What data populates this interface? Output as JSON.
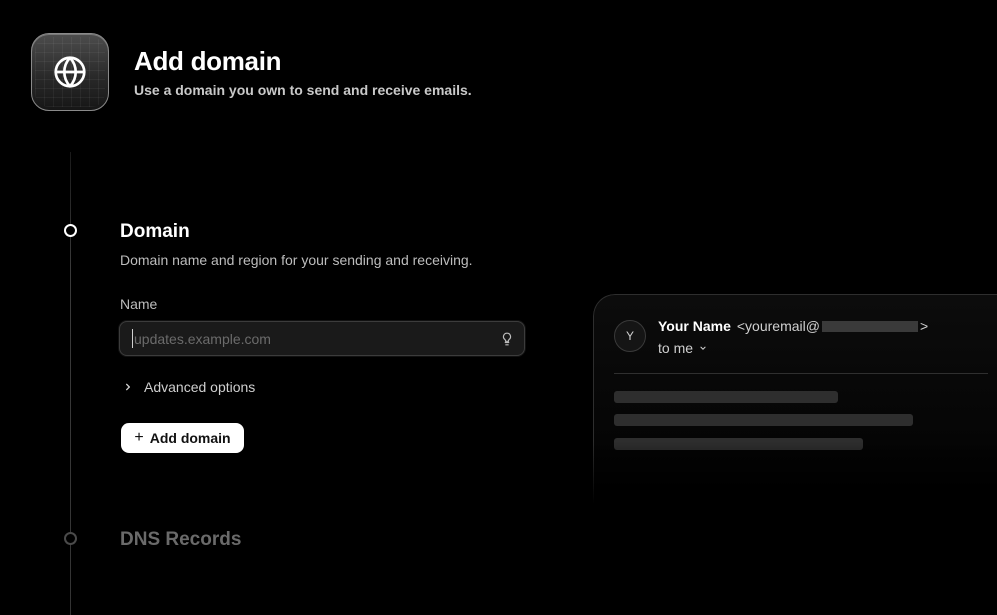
{
  "header": {
    "icon": "globe-icon",
    "title": "Add domain",
    "subtitle": "Use a domain you own to send and receive emails."
  },
  "steps": [
    {
      "title": "Domain",
      "description": "Domain name and region for your sending and receiving.",
      "state": "active"
    },
    {
      "title": "DNS Records",
      "state": "inactive"
    }
  ],
  "form": {
    "name_label": "Name",
    "name_placeholder": "updates.example.com",
    "name_value": "",
    "advanced_label": "Advanced options",
    "submit_label": "Add domain"
  },
  "email_preview": {
    "avatar_initial": "Y",
    "from_name": "Your Name",
    "from_email_prefix": "<youremail@",
    "from_email_suffix": ">",
    "to_label": "to me"
  },
  "colors": {
    "background": "#000000",
    "primary_button": "#ffffff",
    "muted_text": "#bdbdbd",
    "inactive_text": "#6a6a6a"
  }
}
